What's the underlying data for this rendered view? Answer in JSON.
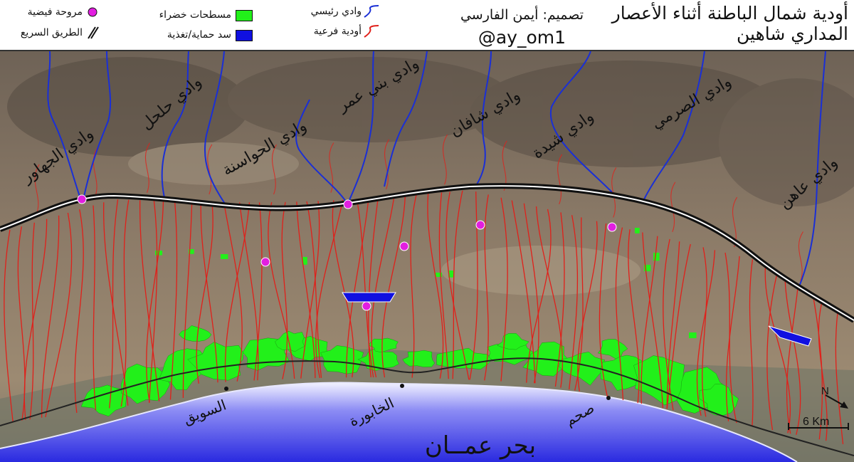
{
  "title": {
    "line1": "أودية شمال الباطنة أثناء الأعصار",
    "line2": "المداري شاهين"
  },
  "credit": {
    "designer": "تصميم: أيمن الفارسي",
    "handle": "@ay_om1"
  },
  "legend": {
    "alluvial_fan": "مروحة فيضية",
    "highway": "الطريق السريع",
    "green_areas": "مسطحات خضراء",
    "dam": "سد حماية/تغذية",
    "main_wadi": "وادي رئيسي",
    "sub_wadi": "أودية فرعية"
  },
  "colors": {
    "main_wadi": "#1a2fd6",
    "sub_wadi": "#e0201a",
    "green": "#22f01a",
    "fan": "#e21ee0",
    "dam": "#1010e0",
    "road": "#111111",
    "sea": "#3a3ae8"
  },
  "wadis": [
    "وادي الجهاور",
    "وادي حلحل",
    "وادي الحواسنة",
    "وادي بني عمر",
    "وادي شافان",
    "وادي شيدة",
    "وادي الصرمي",
    "وادي عاهن"
  ],
  "towns": [
    "السويق",
    "الخابورة",
    "صحم"
  ],
  "sea_label": "بحر عمــان",
  "north": "N",
  "scale": "6 Km"
}
